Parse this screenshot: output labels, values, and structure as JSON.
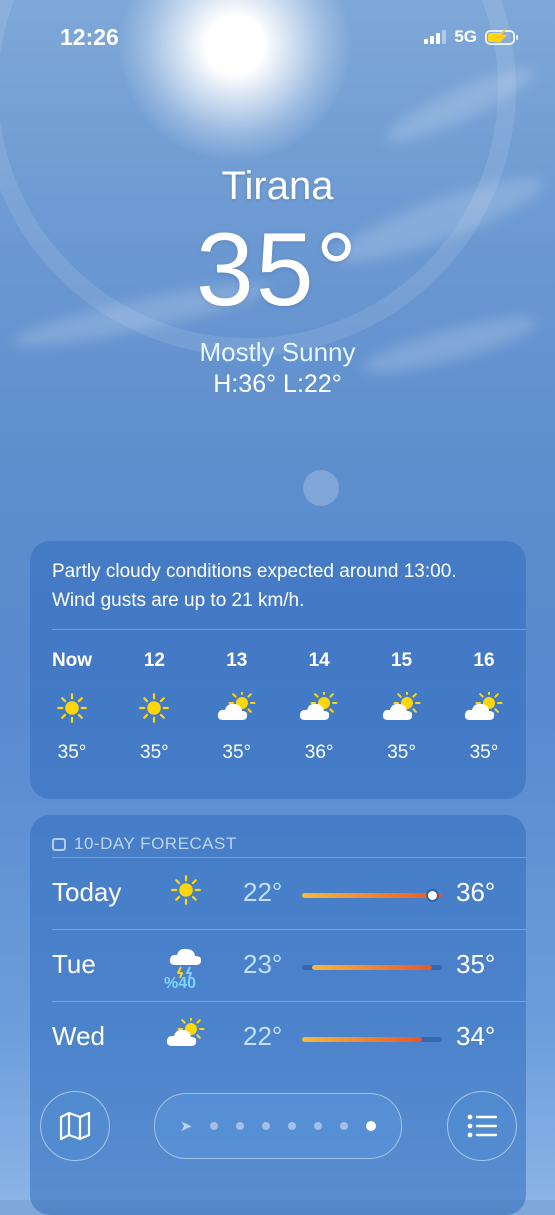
{
  "status_bar": {
    "time": "12:26",
    "network": "5G",
    "battery_state": "charging"
  },
  "location": {
    "city": "Tirana",
    "temperature": "35°",
    "condition": "Mostly Sunny",
    "high_low": "H:36°  L:22°"
  },
  "hourly": {
    "summary": "Partly cloudy conditions expected around 13:00. Wind gusts are up to 21 km/h.",
    "items": [
      {
        "hour": "Now",
        "icon": "sun-icon",
        "temp": "35°"
      },
      {
        "hour": "12",
        "icon": "sun-icon",
        "temp": "35°"
      },
      {
        "hour": "13",
        "icon": "partly-cloudy-icon",
        "temp": "35°"
      },
      {
        "hour": "14",
        "icon": "partly-cloudy-icon",
        "temp": "36°"
      },
      {
        "hour": "15",
        "icon": "partly-cloudy-icon",
        "temp": "35°"
      },
      {
        "hour": "16",
        "icon": "partly-cloudy-icon",
        "temp": "35°"
      }
    ]
  },
  "forecast": {
    "title": "10-DAY FORECAST",
    "days": [
      {
        "day": "Today",
        "icon": "sun-icon",
        "precip": "",
        "low": "22°",
        "high": "36°",
        "current": "35°"
      },
      {
        "day": "Tue",
        "icon": "thunderstorm-icon",
        "precip": "%40",
        "low": "23°",
        "high": "35°"
      },
      {
        "day": "Wed",
        "icon": "partly-cloudy-icon",
        "precip": "",
        "low": "22°",
        "high": "34°"
      }
    ]
  },
  "bottom_bar": {
    "page_count": 8,
    "active_page": 8
  },
  "colors": {
    "sun": "#ffd60a",
    "range_start": "#f6b93b",
    "range_end": "#e8552e",
    "precip": "#7fd3ff"
  }
}
